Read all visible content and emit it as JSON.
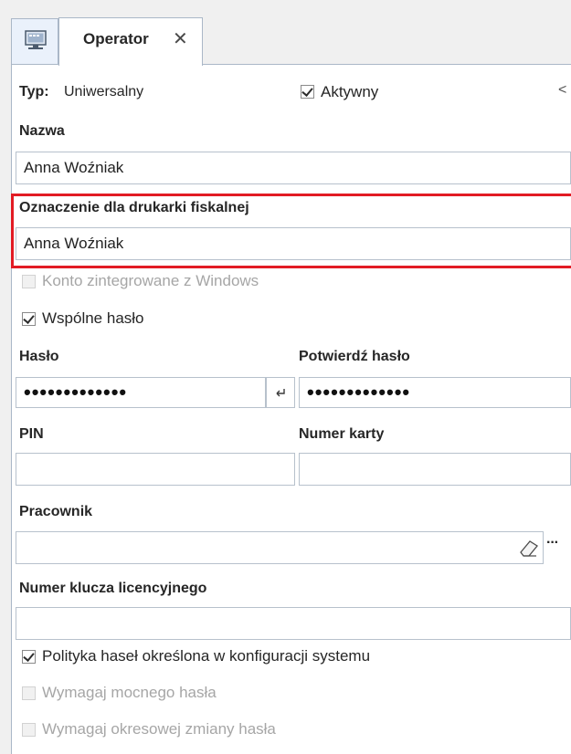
{
  "tabs": {
    "home_icon": "monitor-icon",
    "active_label": "Operator",
    "close_glyph": "✕"
  },
  "form": {
    "typ_label": "Typ:",
    "typ_value": "Uniwersalny",
    "aktywny_label": "Aktywny",
    "aktywny_checked": true,
    "collapse_glyph": "<",
    "nazwa_label": "Nazwa",
    "nazwa_value": "Anna Woźniak",
    "fiscal_label": "Oznaczenie dla drukarki fiskalnej",
    "fiscal_value": "Anna Woźniak",
    "windows_account_label": "Konto zintegrowane z Windows",
    "windows_account_checked": false,
    "shared_password_label": "Wspólne hasło",
    "shared_password_checked": true,
    "password_label": "Hasło",
    "password_value": "•••••••••••••",
    "confirm_password_label": "Potwierdź hasło",
    "confirm_password_value": "•••••••••••••",
    "pin_label": "PIN",
    "pin_value": "",
    "card_number_label": "Numer karty",
    "card_number_value": "",
    "employee_label": "Pracownik",
    "employee_value": "",
    "ellipsis_glyph": "···",
    "license_key_label": "Numer klucza licencyjnego",
    "license_key_value": "",
    "policy_label": "Polityka haseł określona w konfiguracji systemu",
    "policy_checked": true,
    "strong_password_label": "Wymagaj mocnego hasła",
    "periodic_change_label": "Wymagaj okresowej zmiany hasła"
  }
}
